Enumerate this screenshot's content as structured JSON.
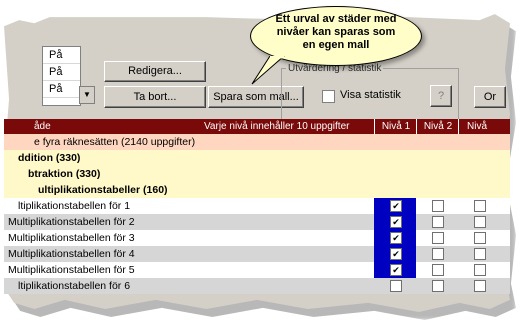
{
  "callout": {
    "text": "Ett urval av städer med nivåer kan sparas som en egen mall"
  },
  "mini_list": {
    "items": [
      "På",
      "På",
      "På"
    ]
  },
  "buttons": {
    "edit": "Redigera...",
    "delete": "Ta bort...",
    "save_template": "Spara som mall...",
    "help": "?",
    "right_partial": "Or"
  },
  "stats_group": {
    "title": "Utvärdering / statistik",
    "checkbox_label": "Visa statistik"
  },
  "grid": {
    "headers": {
      "left": "åde",
      "middle": "Varje nivå innehåller 10 uppgifter",
      "level1": "Nivå 1",
      "level2": "Nivå 2",
      "level3": "Nivå"
    },
    "rows": [
      {
        "label": "e fyra räknesätten (2140 uppgifter)",
        "kind": "cat0",
        "checks": []
      },
      {
        "label": "ddition (330)",
        "kind": "cat",
        "checks": []
      },
      {
        "label": "btraktion (330)",
        "kind": "cat",
        "checks": []
      },
      {
        "label": "ultiplikationstabeller (160)",
        "kind": "cat",
        "checks": []
      },
      {
        "label": "ltiplikationstabellen för 1",
        "kind": "odd",
        "checks": [
          true,
          false,
          false
        ]
      },
      {
        "label": "Multiplikationstabellen för 2",
        "kind": "even",
        "checks": [
          true,
          false,
          false
        ]
      },
      {
        "label": "Multiplikationstabellen för 3",
        "kind": "odd",
        "checks": [
          true,
          false,
          false
        ]
      },
      {
        "label": "Multiplikationstabellen för 4",
        "kind": "even",
        "checks": [
          true,
          false,
          false
        ]
      },
      {
        "label": "Multiplikationstabellen för 5",
        "kind": "odd",
        "checks": [
          true,
          false,
          false
        ]
      },
      {
        "label": "ltiplikationstabellen för 6",
        "kind": "even",
        "checks": [
          false,
          false,
          false
        ]
      }
    ]
  },
  "colors": {
    "header_bg": "#7a0a0a",
    "selected_col": "#0000c0",
    "category_bg": "#fff8c8",
    "callout_bg": "#fffdc8"
  }
}
